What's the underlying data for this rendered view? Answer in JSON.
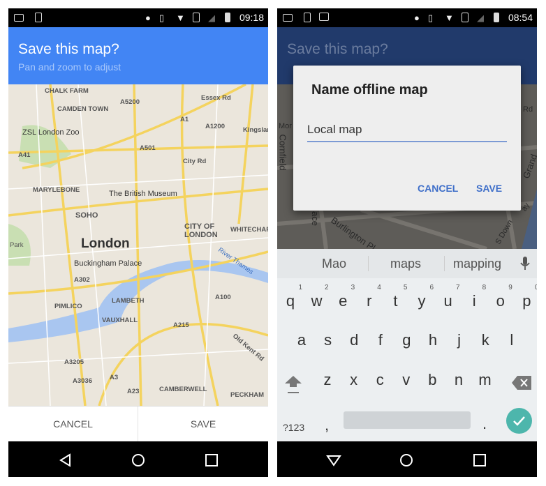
{
  "left": {
    "status": {
      "time": "09:18"
    },
    "appbar": {
      "title": "Save this map?",
      "subtitle": "Pan and zoom to adjust"
    },
    "map": {
      "labels": [
        "CHALK FARM",
        "CAMDEN TOWN",
        "ZSL London Zoo",
        "A5200",
        "A1",
        "Essex Rd",
        "A1200",
        "Kingsland Rd",
        "A41",
        "A501",
        "City Rd",
        "MARYLEBONE",
        "The British Museum",
        "SOHO",
        "CITY OF LONDON",
        "WHITECHAP",
        "Park",
        "London",
        "Buckingham Palace",
        "River Thames",
        "A302",
        "PIMLICO",
        "LAMBETH",
        "VAUXHALL",
        "A215",
        "A100",
        "A3205",
        "A3036",
        "A3",
        "A23",
        "Old Kent Rd",
        "CAMBERWELL",
        "PECKHAM"
      ]
    },
    "buttons": {
      "cancel": "CANCEL",
      "save": "SAVE"
    }
  },
  "right": {
    "status": {
      "time": "08:54"
    },
    "appbar": {
      "title": "Save this map?"
    },
    "map": {
      "labels": [
        "Mor",
        "Cornfield",
        "ace",
        "Burlington Pl",
        "Grand",
        "S Down",
        "ay",
        "Rd"
      ]
    },
    "dialog": {
      "title": "Name offline map",
      "input_value": "Local map",
      "cancel": "CANCEL",
      "save": "SAVE",
      "accent": "#3f6fc9"
    },
    "keyboard": {
      "suggestions": [
        "Mao",
        "maps",
        "mapping"
      ],
      "row1": [
        "q",
        "w",
        "e",
        "r",
        "t",
        "y",
        "u",
        "i",
        "o",
        "p"
      ],
      "row1_hints": [
        "1",
        "2",
        "3",
        "4",
        "5",
        "6",
        "7",
        "8",
        "9",
        "0"
      ],
      "row2": [
        "a",
        "s",
        "d",
        "f",
        "g",
        "h",
        "j",
        "k",
        "l"
      ],
      "row3": [
        "z",
        "x",
        "c",
        "v",
        "b",
        "n",
        "m"
      ],
      "symbols": "?123",
      "comma": ",",
      "period": ".",
      "enter_color": "#4db6ac"
    }
  }
}
